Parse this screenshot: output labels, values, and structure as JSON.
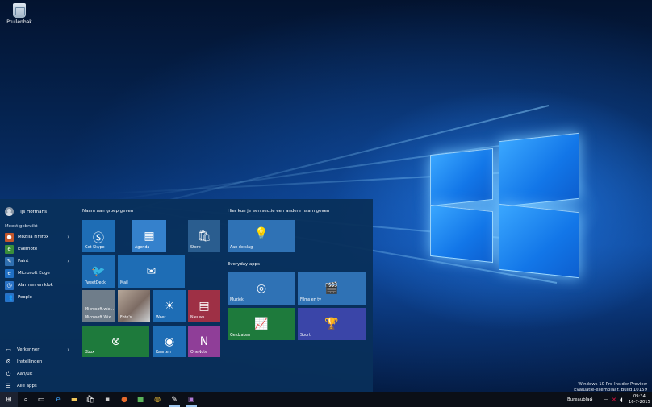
{
  "desktop": {
    "icon_label": "Prullenbak",
    "watermark_line1": "Windows 10 Pro Insider Preview",
    "watermark_line2": "Evaluatie-exemplaar. Build 10159"
  },
  "start_menu": {
    "user_name": "Tijs Hofmans",
    "most_used_label": "Meest gebruikt",
    "apps": [
      {
        "label": "Mozilla Firefox",
        "icon": "firefox-icon",
        "color": "#c3562b"
      },
      {
        "label": "Evernote",
        "icon": "evernote-icon",
        "color": "#3a8f3a"
      },
      {
        "label": "Paint",
        "icon": "paint-icon",
        "color": "#2f6fb0"
      },
      {
        "label": "Microsoft Edge",
        "icon": "edge-icon",
        "color": "#1f6fc4"
      },
      {
        "label": "Alarmen en klok",
        "icon": "alarm-icon",
        "color": "#2a73c6"
      },
      {
        "label": "People",
        "icon": "people-icon",
        "color": "#2a73c6"
      }
    ],
    "system": [
      {
        "label": "Verkenner",
        "icon": "folder-icon"
      },
      {
        "label": "Instellingen",
        "icon": "gear-icon"
      },
      {
        "label": "Aan/uit",
        "icon": "power-icon"
      },
      {
        "label": "Alle apps",
        "icon": "list-icon"
      }
    ],
    "group1_title": "Naam aan groep geven",
    "group2_title": "Hier kun je een sectie een andere naam geven",
    "group3_title": "Everyday apps",
    "tiles": {
      "skype": "Get Skype",
      "agenda": "Agenda",
      "store": "Store",
      "tweetdeck": "TweetDeck",
      "mail": "Mail",
      "microsoft1": "Microsoft.wix...",
      "microsoft2": "Microsoft.Wix...",
      "photos": "Foto's",
      "weather": "Weer",
      "news": "Nieuws",
      "xbox": "Xbox",
      "maps": "Kaarten",
      "onenote": "OneNote",
      "getstarted": "Aan de slag",
      "music": "Muziek",
      "films": "Films en tv",
      "money": "Geldzaken",
      "sport": "Sport"
    }
  },
  "taskbar": {
    "desktop_label": "Bureaublad",
    "time": "09:34",
    "date": "16-7-2015"
  },
  "colors": {
    "accent": "#1e6db5",
    "tile_dark": "#2a5d8f",
    "green": "#1e7a3c",
    "news": "#9e3045",
    "onenote": "#8f3e98",
    "sport": "#3a45a8"
  }
}
